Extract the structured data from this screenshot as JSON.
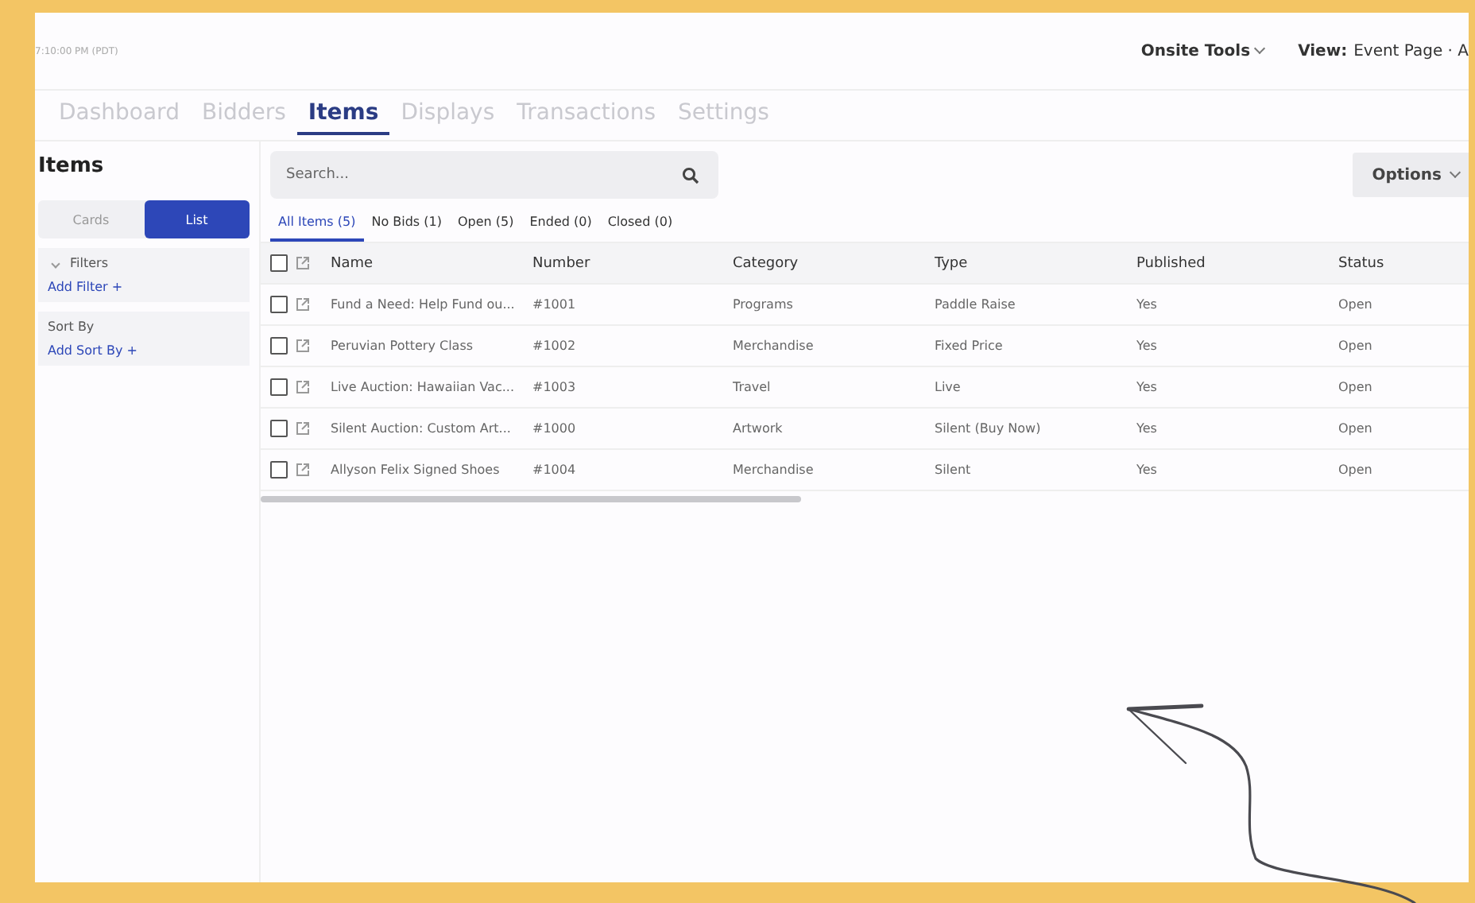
{
  "header": {
    "time": "7:10:00 PM (PDT)",
    "onsite_tools": "Onsite Tools",
    "view_label": "View:",
    "view_value": "Event Page · A"
  },
  "nav_tabs": [
    {
      "label": "Dashboard",
      "selected": false
    },
    {
      "label": "Bidders",
      "selected": false
    },
    {
      "label": "Items",
      "selected": true
    },
    {
      "label": "Displays",
      "selected": false
    },
    {
      "label": "Transactions",
      "selected": false
    },
    {
      "label": "Settings",
      "selected": false
    }
  ],
  "sidebar": {
    "title": "Items",
    "view_toggle": [
      {
        "label": "Cards",
        "selected": false
      },
      {
        "label": "List",
        "selected": true
      }
    ],
    "filters_label": "Filters",
    "add_filter": "Add Filter +",
    "sort_label": "Sort By",
    "add_sort": "Add Sort By +"
  },
  "search": {
    "placeholder": "Search..."
  },
  "options_button": "Options",
  "filter_tabs": [
    {
      "label": "All Items (5)",
      "selected": true
    },
    {
      "label": "No Bids (1)",
      "selected": false
    },
    {
      "label": "Open (5)",
      "selected": false
    },
    {
      "label": "Ended (0)",
      "selected": false
    },
    {
      "label": "Closed (0)",
      "selected": false
    }
  ],
  "table": {
    "select_all_checked": false,
    "columns": [
      "Name",
      "Number",
      "Category",
      "Type",
      "Published",
      "Status"
    ],
    "rows": [
      {
        "checked": false,
        "cells": [
          "Fund a Need: Help Fund ou...",
          "#1001",
          "Programs",
          "Paddle Raise",
          "Yes",
          "Open"
        ]
      },
      {
        "checked": false,
        "cells": [
          "Peruvian Pottery Class",
          "#1002",
          "Merchandise",
          "Fixed Price",
          "Yes",
          "Open"
        ]
      },
      {
        "checked": false,
        "cells": [
          "Live Auction: Hawaiian Vac...",
          "#1003",
          "Travel",
          "Live",
          "Yes",
          "Open"
        ]
      },
      {
        "checked": false,
        "cells": [
          "Silent Auction: Custom Art...",
          "#1000",
          "Artwork",
          "Silent (Buy Now)",
          "Yes",
          "Open"
        ]
      },
      {
        "checked": false,
        "cells": [
          "Allyson Felix Signed Shoes",
          "#1004",
          "Merchandise",
          "Silent",
          "Yes",
          "Open"
        ]
      }
    ]
  }
}
